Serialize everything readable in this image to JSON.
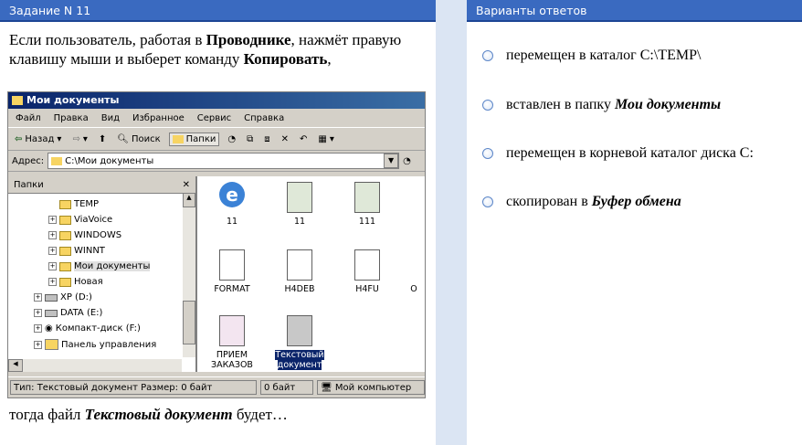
{
  "left_panel": {
    "title": "Задание N 11"
  },
  "right_panel": {
    "title": "Варианты ответов"
  },
  "question": {
    "p1": "Если пользователь, работая в ",
    "p1b": "Проводнике",
    "p2": ", нажмёт правую клавишу мыши и выберет команду ",
    "p2b": "Копировать",
    "p3": ",",
    "tail1": "тогда файл ",
    "tail_b": "Текстовый документ",
    "tail2": " будет…"
  },
  "explorer": {
    "title": "Мои документы",
    "menu": [
      "Файл",
      "Правка",
      "Вид",
      "Избранное",
      "Сервис",
      "Справка"
    ],
    "toolbar": {
      "back": "Назад",
      "search": "Поиск",
      "folders": "Папки"
    },
    "address_label": "Адрес:",
    "address_value": "C:\\Мои документы",
    "folders_title": "Папки",
    "tree": [
      "TEMP",
      "ViaVoice",
      "WINDOWS",
      "WINNT",
      "Мои документы",
      "Новая",
      "XP (D:)",
      "DATA (E:)",
      "Компакт-диск (F:)",
      "Панель управления"
    ],
    "files": [
      "11",
      "11",
      "111",
      "FORMAT",
      "H4DEB",
      "H4FU",
      "O",
      "ПРИЕМ ЗАКАЗОВ",
      "Текстовый документ"
    ],
    "status": [
      "Тип: Текстовый документ Размер: 0 байт",
      "0 байт",
      "Мой компьютер"
    ]
  },
  "answers": [
    {
      "text": "перемещен в каталог C:\\TEMP\\",
      "bold": ""
    },
    {
      "text": "вставлен в папку ",
      "bold": "Мои документы"
    },
    {
      "text": "перемещен в корневой каталог диска C:",
      "bold": ""
    },
    {
      "text": "скопирован в ",
      "bold": "Буфер обмена"
    }
  ]
}
